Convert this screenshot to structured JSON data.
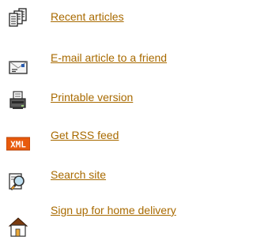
{
  "tools": {
    "colors": {
      "link": "#a86a00"
    },
    "items": [
      {
        "label": "Recent articles",
        "icon": "documents-icon"
      },
      {
        "label": "E-mail article to a friend",
        "icon": "envelope-icon"
      },
      {
        "label": "Printable version",
        "icon": "printer-icon"
      },
      {
        "label": "Get RSS feed",
        "icon": "xml-feed-icon"
      },
      {
        "label": "Search site",
        "icon": "magnifier-search-icon"
      },
      {
        "label": "Sign up for home delivery",
        "icon": "house-icon"
      }
    ]
  }
}
